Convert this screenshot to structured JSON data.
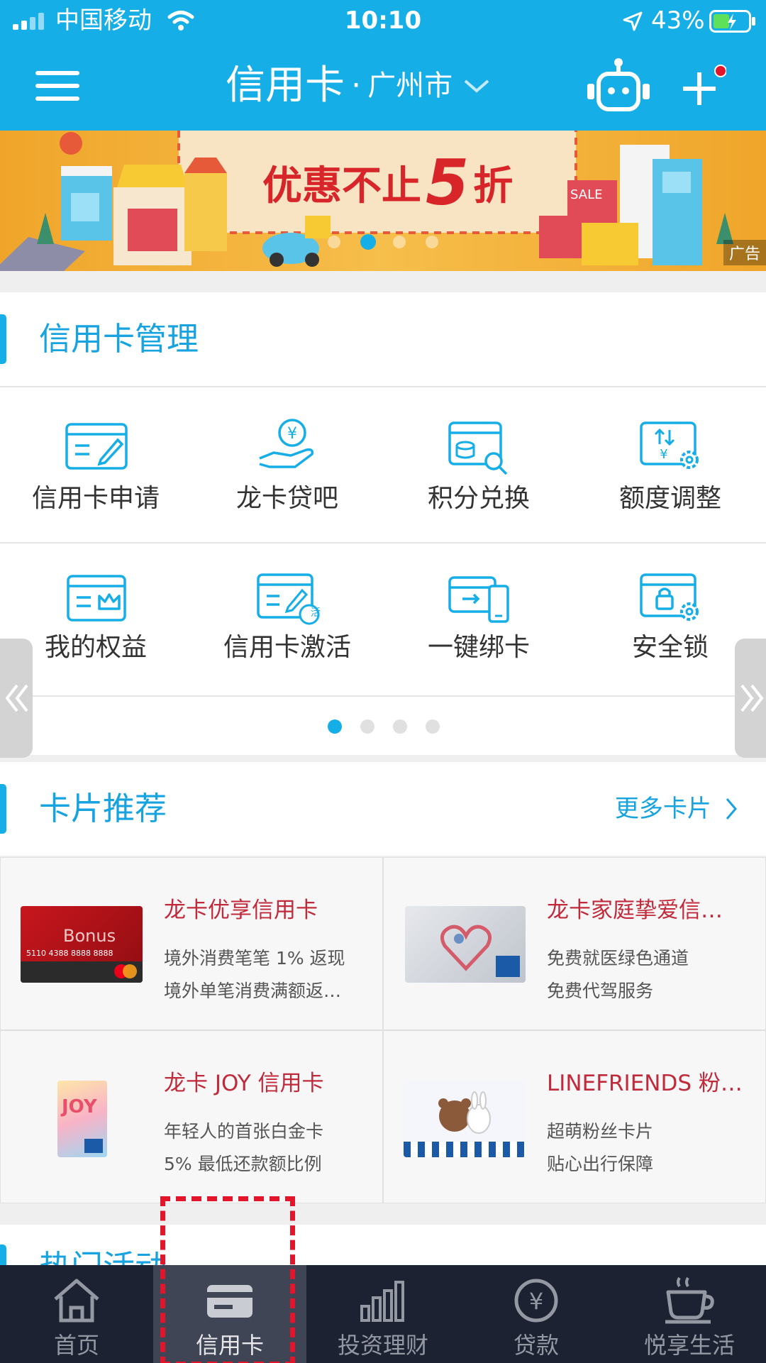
{
  "status_bar": {
    "carrier": "中国移动",
    "time": "10:10",
    "battery": "43%"
  },
  "nav": {
    "title": "信用卡",
    "separator": "·",
    "city": "广州市"
  },
  "banner": {
    "headline_prefix": "优惠不止",
    "headline_number": "5",
    "headline_suffix": "折",
    "ad_tag": "广告",
    "sale_sign": "SALE"
  },
  "management": {
    "title": "信用卡管理",
    "items": [
      {
        "label": "信用卡申请",
        "icon": "card-pen-icon"
      },
      {
        "label": "龙卡贷吧",
        "icon": "yuan-hand-icon"
      },
      {
        "label": "积分兑换",
        "icon": "points-search-icon"
      },
      {
        "label": "额度调整",
        "icon": "limit-adjust-icon"
      },
      {
        "label": "我的权益",
        "icon": "card-crown-icon"
      },
      {
        "label": "信用卡激活",
        "icon": "card-activate-icon"
      },
      {
        "label": "一键绑卡",
        "icon": "bind-card-icon"
      },
      {
        "label": "安全锁",
        "icon": "lock-gear-icon"
      }
    ],
    "activate_badge": "活",
    "page_count": 4,
    "current_page": 1
  },
  "recommend": {
    "title": "卡片推荐",
    "more": "更多卡片",
    "cards": [
      {
        "name": "龙卡优享信用卡",
        "desc1": "境外消费笔笔 1% 返现",
        "desc2": "境外单笔消费满额返…",
        "card_text": "Bonus",
        "card_number": "5110  4388  8888  8888"
      },
      {
        "name": "龙卡家庭挚爱信…",
        "desc1": "免费就医绿色通道",
        "desc2": "免费代驾服务"
      },
      {
        "name": "龙卡 JOY 信用卡",
        "desc1": "年轻人的首张白金卡",
        "desc2": "5% 最低还款额比例",
        "card_text": "JOY"
      },
      {
        "name": "LINEFRIENDS 粉…",
        "desc1": "超萌粉丝卡片",
        "desc2": "贴心出行保障"
      }
    ]
  },
  "next_section": {
    "title": "热门活动"
  },
  "tabbar": {
    "tabs": [
      {
        "label": "首页",
        "icon": "home-icon"
      },
      {
        "label": "信用卡",
        "icon": "credit-card-icon"
      },
      {
        "label": "投资理财",
        "icon": "bar-chart-icon"
      },
      {
        "label": "贷款",
        "icon": "yuan-circle-icon"
      },
      {
        "label": "悦享生活",
        "icon": "coffee-icon"
      }
    ],
    "active_index": 1
  },
  "colors": {
    "primary": "#16aee6",
    "card_title": "#c12a3b",
    "tabbar_bg": "#1d2232",
    "highlight_box": "#e3152b"
  }
}
